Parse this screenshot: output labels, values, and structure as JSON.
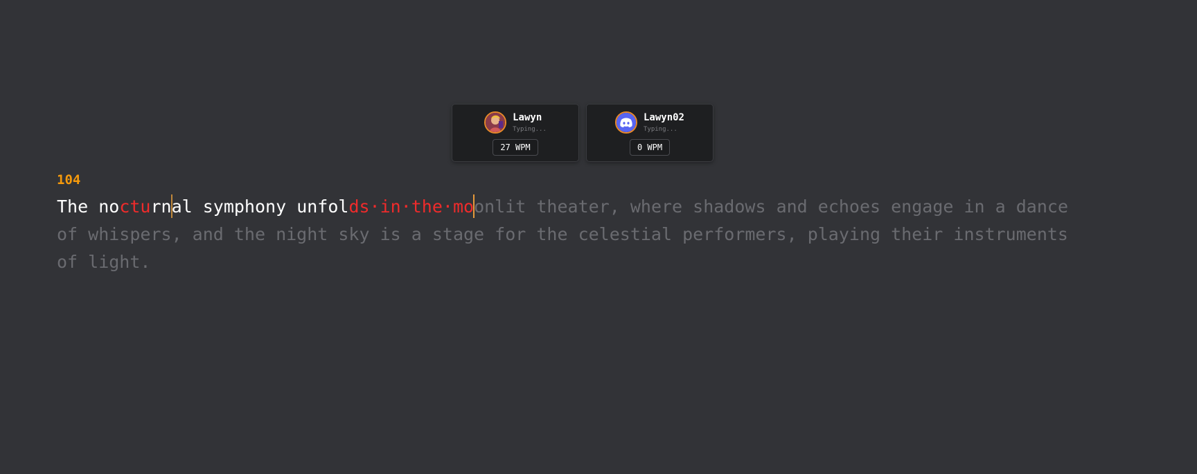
{
  "players": [
    {
      "name": "Lawyn",
      "status": "Typing...",
      "wpm": "27 WPM",
      "avatar_icon": "character-portrait-icon"
    },
    {
      "name": "Lawyn02",
      "status": "Typing...",
      "wpm": "0 WPM",
      "avatar_icon": "discord-default-avatar-icon"
    }
  ],
  "race": {
    "countdown": "104",
    "segments": [
      {
        "text": "The no",
        "state": "typed"
      },
      {
        "text": "ctu",
        "state": "error"
      },
      {
        "text": "rn",
        "state": "typed"
      },
      {
        "text": "al symphony unfol",
        "state": "typed"
      },
      {
        "text": "ds·in·the·mo",
        "state": "error"
      },
      {
        "text": "onlit theater, where shadows and echoes engage in a dance of whispers, and the night sky is a stage for the celestial performers, playing their instruments of light.",
        "state": "pending"
      }
    ]
  },
  "colors": {
    "background": "#323337",
    "accent": "#f59a0c",
    "error": "#ef2b2b",
    "pending_text": "#6a6b70",
    "typed_text": "#ffffff"
  }
}
